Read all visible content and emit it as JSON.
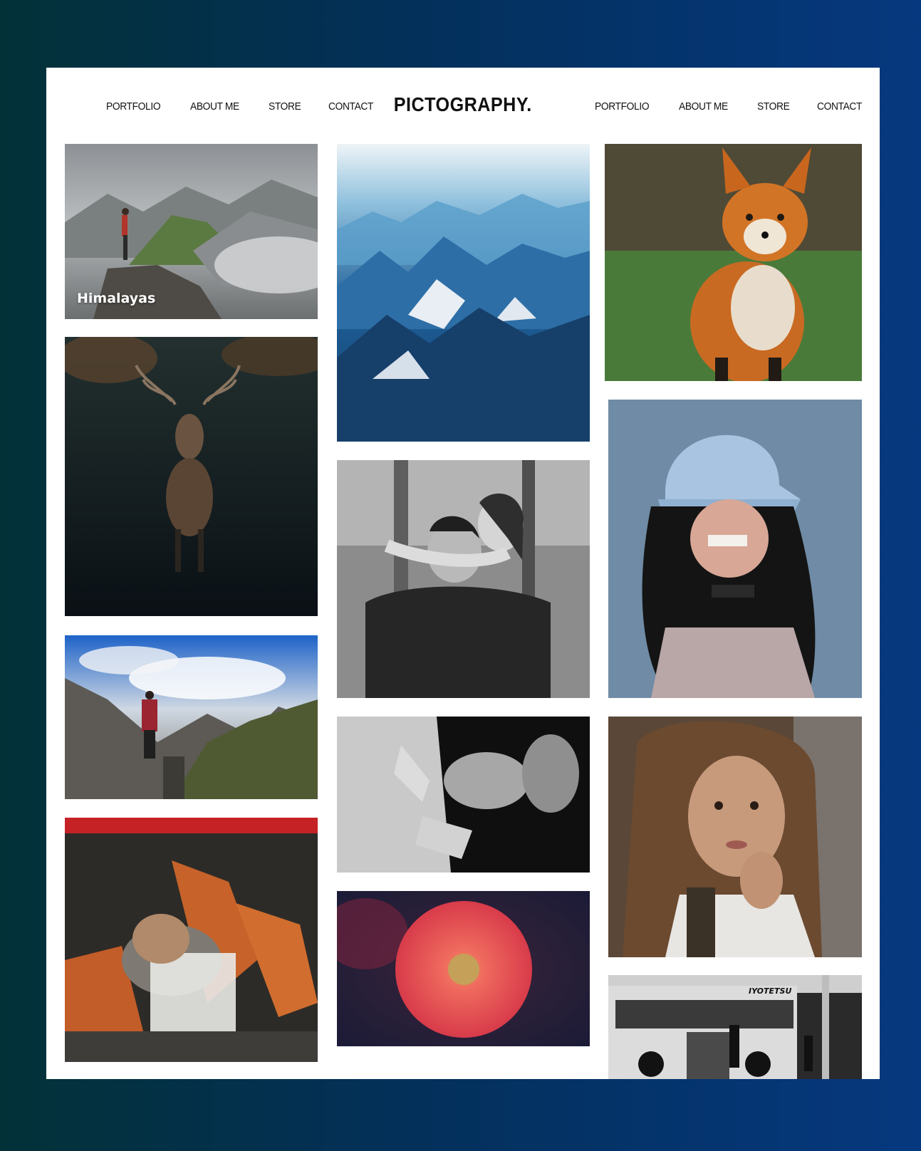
{
  "site": {
    "brand": "PICTOGRAPHY.",
    "nav_left": [
      "PORTFOLIO",
      "ABOUT ME",
      "STORE",
      "CONTACT"
    ],
    "nav_right": [
      "PORTFOLIO",
      "ABOUT ME",
      "STORE",
      "CONTACT"
    ]
  },
  "gallery": {
    "captions": {
      "hiker": "Himalayas"
    },
    "bus_sign": "IYOTETSU"
  },
  "colors": {
    "background_left": "#033138",
    "background_right": "#06387f",
    "card": "#ffffff",
    "text": "#111111"
  }
}
